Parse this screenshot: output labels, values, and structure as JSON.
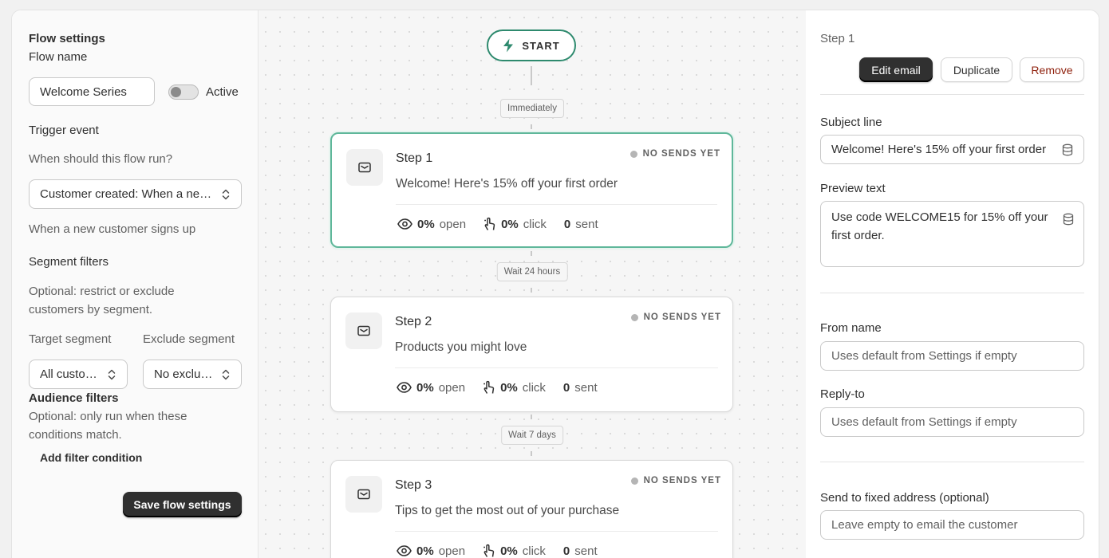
{
  "flow_settings": {
    "title": "Flow settings",
    "flow_name_label": "Flow name",
    "flow_name_value": "Welcome Series",
    "active_label": "Active",
    "trigger_title": "Trigger event",
    "trigger_question": "When should this flow run?",
    "trigger_value": "Customer created: When a new customer signs up",
    "trigger_help": "When a new customer signs up",
    "segment_title": "Segment filters",
    "segment_help": "Optional: restrict or exclude customers by segment.",
    "target_label": "Target segment",
    "target_value": "All customers",
    "exclude_label": "Exclude segment",
    "exclude_value": "No exclusion",
    "audience_title": "Audience filters",
    "audience_help": "Optional: only run when these conditions match.",
    "add_filter_label": "Add filter condition",
    "save_label": "Save flow settings"
  },
  "canvas": {
    "start_label": "START",
    "waits": [
      "Immediately",
      "Wait 24 hours",
      "Wait 7 days"
    ],
    "steps": [
      {
        "label": "Step 1",
        "subject": "Welcome! Here's 15% off your first order",
        "status": "NO SENDS YET",
        "open_pct": "0%",
        "open_label": "open",
        "click_pct": "0%",
        "click_label": "click",
        "sent_count": "0",
        "sent_label": "sent",
        "selected": true
      },
      {
        "label": "Step 2",
        "subject": "Products you might love",
        "status": "NO SENDS YET",
        "open_pct": "0%",
        "open_label": "open",
        "click_pct": "0%",
        "click_label": "click",
        "sent_count": "0",
        "sent_label": "sent",
        "selected": false
      },
      {
        "label": "Step 3",
        "subject": "Tips to get the most out of your purchase",
        "status": "NO SENDS YET",
        "open_pct": "0%",
        "open_label": "open",
        "click_pct": "0%",
        "click_label": "click",
        "sent_count": "0",
        "sent_label": "sent",
        "selected": false
      }
    ]
  },
  "step_panel": {
    "title": "Step 1",
    "edit_label": "Edit email",
    "duplicate_label": "Duplicate",
    "remove_label": "Remove",
    "subject_label": "Subject line",
    "subject_value": "Welcome! Here's 15% off your first order",
    "preview_label": "Preview text",
    "preview_value": "Use code WELCOME15 for 15% off your first order.",
    "from_label": "From name",
    "from_placeholder": "Uses default from Settings if empty",
    "reply_label": "Reply-to",
    "reply_placeholder": "Uses default from Settings if empty",
    "fixed_label": "Send to fixed address (optional)",
    "fixed_placeholder": "Leave empty to email the customer"
  },
  "colors": {
    "accent_green": "#2e8a6e",
    "selected_border": "#5fb79a",
    "remove_red": "#8e1f0b",
    "dark_button": "#303030"
  }
}
